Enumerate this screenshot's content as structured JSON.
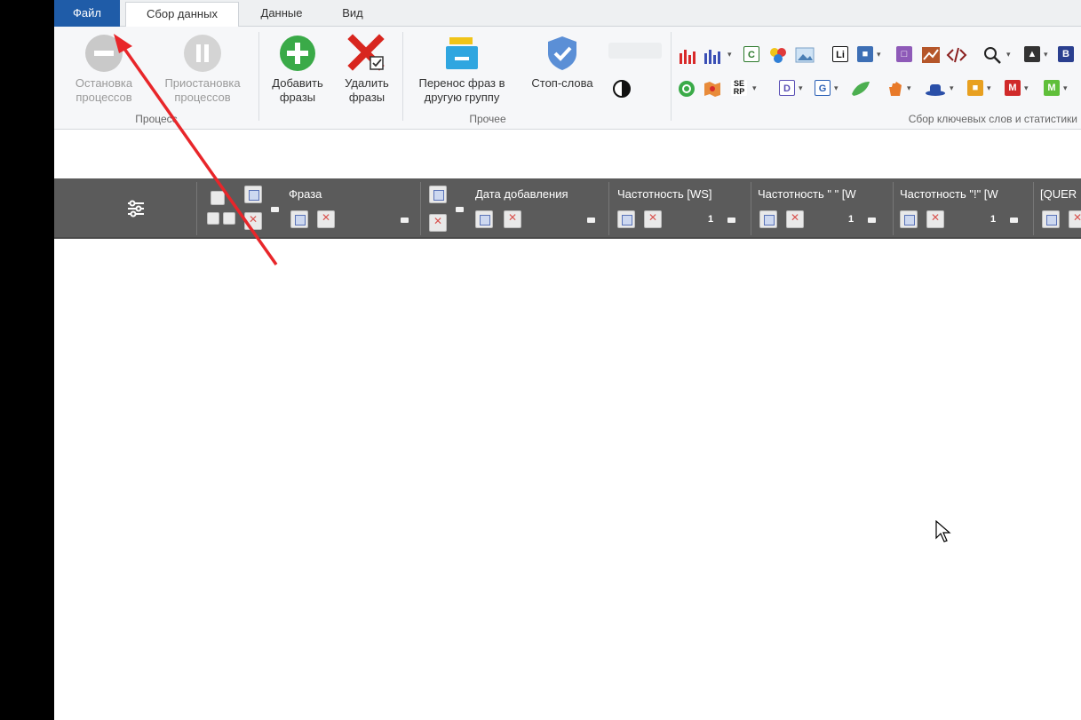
{
  "tabs": {
    "file": "Файл",
    "data_collection": "Сбор данных",
    "data": "Данные",
    "view": "Вид"
  },
  "ribbon": {
    "stop_processes": "Остановка\nпроцессов",
    "pause_processes": "Приостановка\nпроцессов",
    "add_phrases": "Добавить\nфразы",
    "delete_phrases": "Удалить\nфразы",
    "move_phrases": "Перенос фраз в\nдругую группу",
    "stop_words": "Стоп-слова",
    "group_process": "Процесс",
    "group_other": "Прочее",
    "group_keywords": "Сбор ключевых слов и статистики"
  },
  "grid": {
    "columns": [
      "Фраза",
      "Дата добавления",
      "Частотность [WS]",
      "Частотность \" \" [W",
      "Частотность \"!\" [W",
      "[QUER"
    ]
  },
  "icons": {
    "stop": "stop-circle-icon",
    "pause": "pause-circle-icon",
    "add": "plus-circle-icon",
    "delete": "red-x-icon",
    "move": "folder-move-icon",
    "stopwords": "shield-check-icon",
    "settings": "column-settings-icon"
  },
  "colors": {
    "file_tab": "#1f5ca8",
    "grid_header": "#5b5b5b",
    "annotation_arrow": "#e8262a"
  }
}
